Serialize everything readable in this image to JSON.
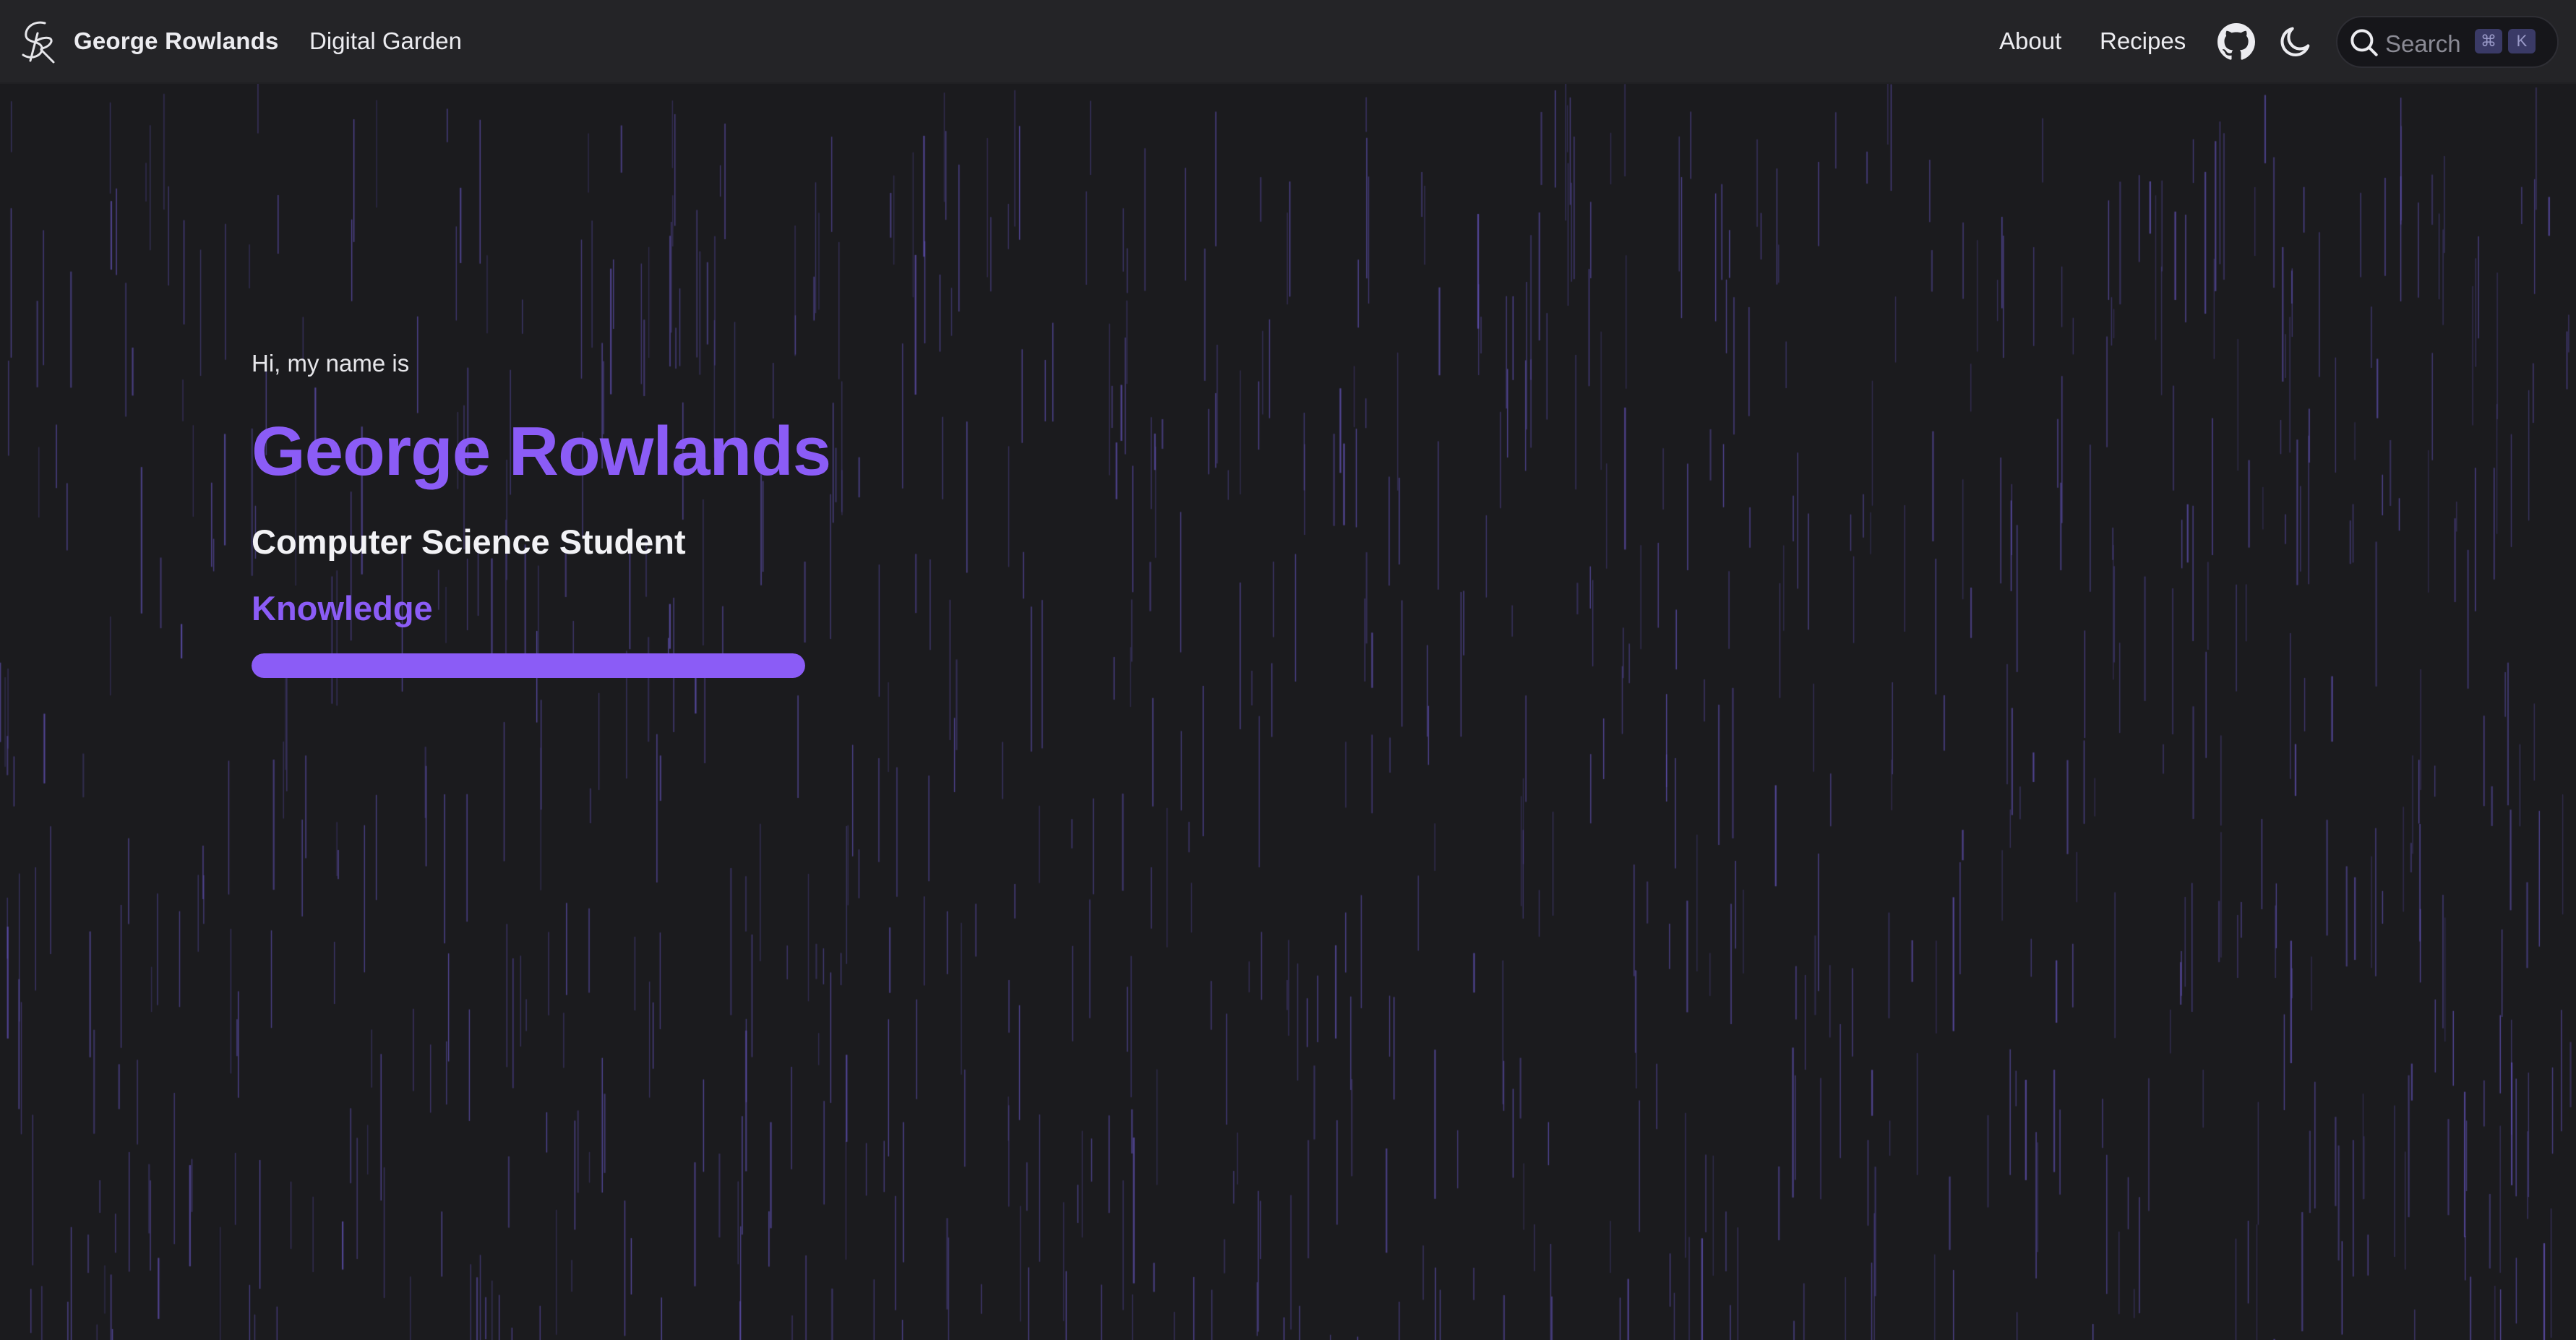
{
  "header": {
    "logo_icon": "signature-logo-icon",
    "site_title": "George Rowlands",
    "nav_left": [
      {
        "label": "Digital Garden"
      }
    ],
    "nav_right": [
      {
        "label": "About"
      },
      {
        "label": "Recipes"
      }
    ],
    "github_icon": "github-icon",
    "theme_icon": "moon-icon",
    "search": {
      "placeholder": "Search",
      "shortcut_keys": [
        "⌘",
        "K"
      ]
    }
  },
  "hero": {
    "greeting": "Hi, my name is",
    "name": "George Rowlands",
    "subtitle": "Computer Science Student",
    "rotating_word": "Knowledge",
    "progress": 1.0
  },
  "colors": {
    "background": "#1b1b1e",
    "navbar": "#242427",
    "accent": "#8b5cf6",
    "rain": "#6d5bd0"
  }
}
